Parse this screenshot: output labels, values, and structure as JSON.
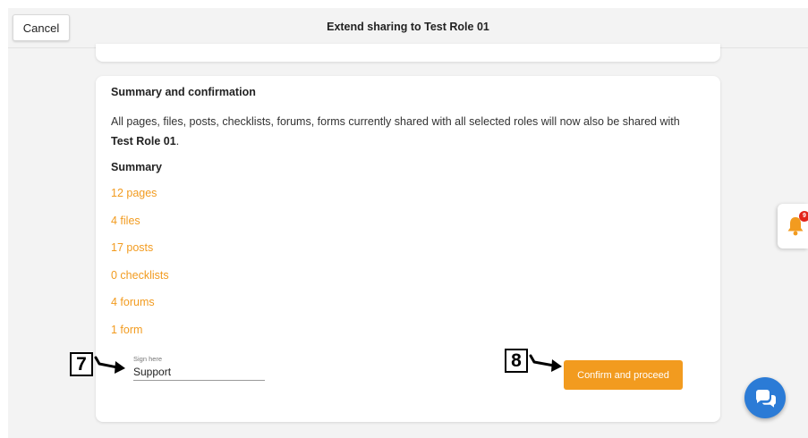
{
  "header": {
    "cancel_label": "Cancel",
    "title": "Extend sharing to Test Role 01"
  },
  "summary_card": {
    "heading": "Summary and confirmation",
    "description_prefix": "All pages, files, posts, checklists, forums, forms currently shared with all selected roles will now also be shared with ",
    "role_name": "Test Role 01",
    "description_suffix": ".",
    "summary_heading": "Summary",
    "items": [
      {
        "label": "12 pages"
      },
      {
        "label": "4 files"
      },
      {
        "label": "17 posts"
      },
      {
        "label": "0 checklists"
      },
      {
        "label": "4 forums"
      },
      {
        "label": "1 form"
      }
    ],
    "signature": {
      "label": "Sign here",
      "value": "Support"
    },
    "confirm_label": "Confirm and proceed"
  },
  "annotations": {
    "step_7": "7",
    "step_8": "8"
  },
  "notifications": {
    "badge_count": "9",
    "icon": "bell-icon"
  },
  "chat": {
    "icon": "chat-bubbles-icon"
  },
  "colors": {
    "accent": "#f29b1f",
    "chat_button": "#2b7bd6",
    "badge": "#e2231a",
    "background": "#f3f3f3"
  }
}
